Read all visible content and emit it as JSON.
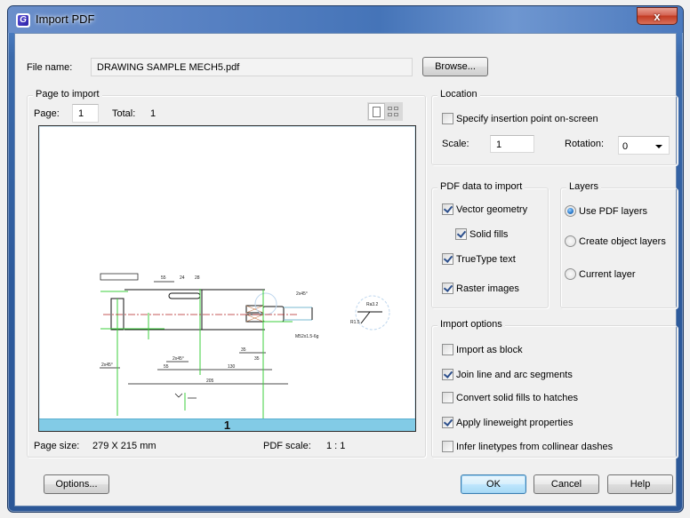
{
  "window": {
    "title": "Import PDF",
    "app_icon": "gstarcad-logo-icon",
    "close_label": "x"
  },
  "file": {
    "label": "File name:",
    "value": "DRAWING SAMPLE MECH5.pdf",
    "browse_label": "Browse..."
  },
  "page_to_import": {
    "title": "Page to import",
    "page_label": "Page:",
    "page_value": "1",
    "total_label": "Total:",
    "total_value": "1",
    "view_modes": [
      "single-page-view-icon",
      "thumbnail-grid-view-icon"
    ],
    "preview_page_number": "1",
    "page_size_label": "Page size:",
    "page_size_value": "279 X 215 mm",
    "pdf_scale_label": "PDF scale:",
    "pdf_scale_value": "1 : 1"
  },
  "location": {
    "title": "Location",
    "specify_insertion_label": "Specify insertion point on-screen",
    "specify_insertion_checked": false,
    "scale_label": "Scale:",
    "scale_value": "1",
    "rotation_label": "Rotation:",
    "rotation_value": "0"
  },
  "pdf_data": {
    "title": "PDF data to import",
    "items": [
      {
        "label": "Vector geometry",
        "checked": true
      },
      {
        "label": "Solid fills",
        "checked": true
      },
      {
        "label": "TrueType text",
        "checked": true
      },
      {
        "label": "Raster images",
        "checked": true
      }
    ]
  },
  "layers": {
    "title": "Layers",
    "options": [
      {
        "label": "Use PDF layers",
        "selected": true
      },
      {
        "label": "Create object layers",
        "selected": false
      },
      {
        "label": "Current layer",
        "selected": false
      }
    ]
  },
  "import_options": {
    "title": "Import options",
    "items": [
      {
        "label": "Import as block",
        "checked": false
      },
      {
        "label": "Join line and arc segments",
        "checked": true
      },
      {
        "label": "Convert solid fills to hatches",
        "checked": false
      },
      {
        "label": "Apply lineweight properties",
        "checked": true
      },
      {
        "label": "Infer linetypes from collinear dashes",
        "checked": false
      }
    ]
  },
  "buttons": {
    "options": "Options...",
    "ok": "OK",
    "cancel": "Cancel",
    "help": "Help"
  },
  "drawing_labels": {
    "dims_top": [
      "55",
      "24",
      "28"
    ],
    "dims_bottom": [
      "55",
      "130",
      "205",
      "35",
      "35"
    ],
    "chamfer": [
      "2x45°",
      "2x45°",
      "2x45°"
    ],
    "thread": "M52x1.5-6g",
    "detail_roughness": "Ra3.2",
    "detail_radius": "R1.5"
  },
  "colors": {
    "title_bar": "#4574b8",
    "preview_footer": "#82cbe6",
    "ok_button": "#bee6fd",
    "close_button": "#c23a22",
    "drawing_green": "#3ccf3c",
    "drawing_centerline": "#b22222"
  }
}
